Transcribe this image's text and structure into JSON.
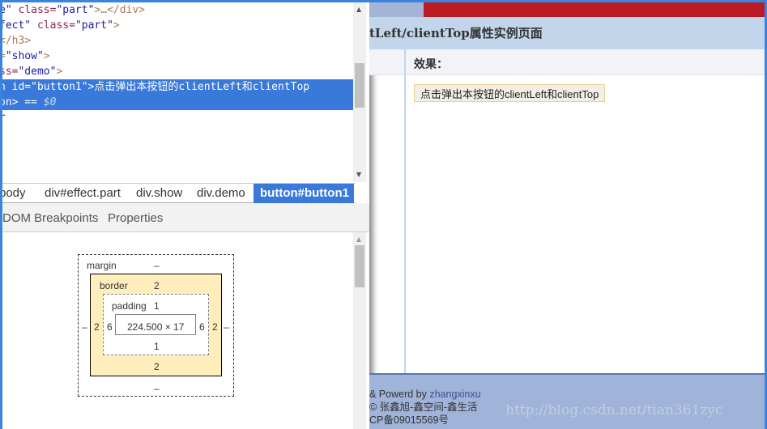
{
  "devtools": {
    "code_lines": [
      {
        "parts": [
          [
            "v",
            "e\""
          ],
          [
            "t",
            " class="
          ],
          [
            "v",
            "\"part\""
          ],
          [
            "p",
            ">…</div>"
          ]
        ]
      },
      {
        "parts": [
          [
            "v",
            "fect\""
          ],
          [
            "t",
            " class="
          ],
          [
            "v",
            "\"part\""
          ],
          [
            "p",
            ">"
          ]
        ]
      },
      {
        "parts": [
          [
            "p",
            "</h3>"
          ]
        ]
      },
      {
        "parts": [
          [
            "p",
            "="
          ],
          [
            "v",
            "\"show\""
          ],
          [
            "p",
            ">"
          ]
        ]
      },
      {
        "parts": [
          [
            "t",
            "ss="
          ],
          [
            "v",
            "\"demo\""
          ],
          [
            "p",
            ">"
          ]
        ]
      },
      {
        "parts": [
          [
            "t",
            "n id="
          ],
          [
            "v",
            "\"button1\""
          ],
          [
            "p",
            ">"
          ],
          [
            "x",
            "点击弹出本按钮的clientLeft和clientTop"
          ]
        ]
      },
      {
        "parts": [
          [
            "t",
            "on"
          ],
          [
            "p",
            "> == "
          ],
          [
            "x",
            "$0"
          ]
        ]
      },
      {
        "parts": [
          [
            "t",
            "r"
          ]
        ]
      }
    ],
    "breadcrumbs": [
      "body",
      "div#effect.part",
      "div.show",
      "div.demo",
      "button#button1"
    ],
    "tabs": [
      "DOM Breakpoints",
      "Properties"
    ],
    "box_model": {
      "margin_label": "margin",
      "margin_top": "–",
      "margin_bottom": "–",
      "margin_left": "–",
      "margin_right": "–",
      "border_label": "border",
      "border_top": "2",
      "border_bottom": "2",
      "border_left": "2",
      "border_right": "2",
      "padding_label": "padding",
      "padding_top": "1",
      "padding_bottom": "1",
      "padding_left": "6",
      "padding_right": "6",
      "content": "224.500 × 17"
    }
  },
  "page": {
    "title": "tLeft/clientTop属性实例页面",
    "effect_label": "效果：",
    "button_label": "点击弹出本按钮的clientLeft和clientTop",
    "footer": [
      "& Powerd by ",
      "zhangxinxu",
      "© 张鑫旭-鑫空间-鑫生活",
      "CP备09015569号"
    ],
    "watermark": "http://blog.csdn.net/tian361zyc",
    "colors": {
      "header_red": "#bd1b24",
      "title_bar": "#c2d5ea",
      "footer": "#a0b3d8",
      "selection": "#3879d9"
    }
  }
}
